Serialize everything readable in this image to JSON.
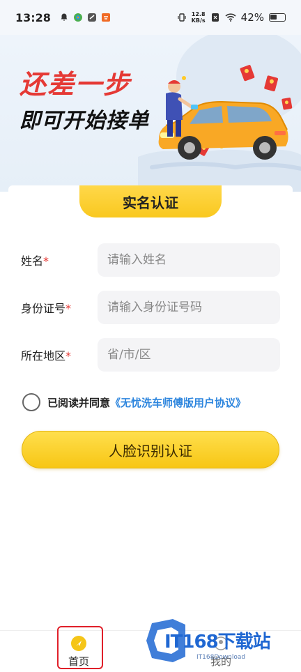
{
  "status_bar": {
    "time": "13:28",
    "net_speed_value": "12.8",
    "net_speed_unit": "KB/s",
    "battery": "42%",
    "icons": [
      "bell-icon",
      "app-icon",
      "link-icon",
      "shop-icon",
      "vibrate-icon",
      "sim-icon",
      "wifi-icon",
      "battery-icon"
    ]
  },
  "hero": {
    "title_line1": "还差一步",
    "title_line2": "即可开始接单",
    "accent_color": "#e53935"
  },
  "card": {
    "tab_title": "实名认证"
  },
  "form": {
    "name": {
      "label": "姓名",
      "required": "*",
      "placeholder": "请输入姓名"
    },
    "id_number": {
      "label": "身份证号",
      "required": "*",
      "placeholder": "请输入身份证号码"
    },
    "region": {
      "label": "所在地区",
      "required": "*",
      "placeholder": "省/市/区"
    }
  },
  "agreement": {
    "prefix": "已阅读并同意",
    "link": "《无忧洗车师傅版用户协议》"
  },
  "face_button_label": "人脸识别认证",
  "bottom_nav": {
    "home_label": "首页",
    "mine_label": "我的"
  },
  "watermark": {
    "main": "IT168下载站",
    "sub": "IT168Download"
  },
  "colors": {
    "primary_yellow": "#f9c81f",
    "link_blue": "#2e86de",
    "required_red": "#e53935"
  }
}
